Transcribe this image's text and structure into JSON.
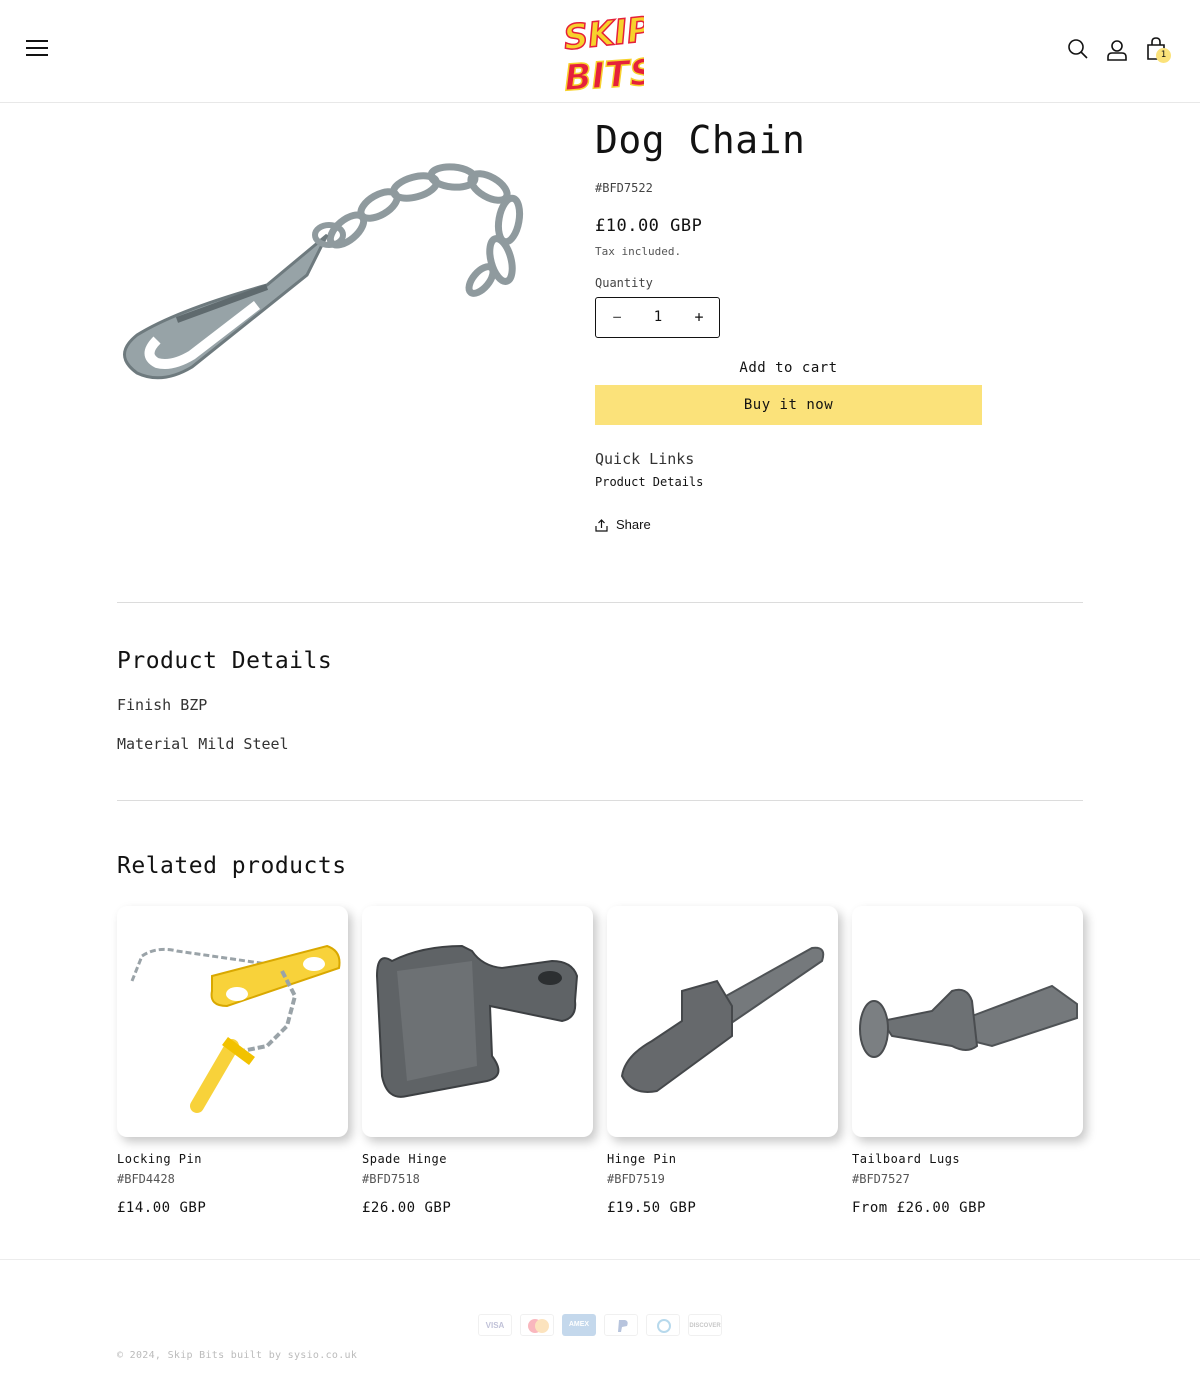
{
  "header": {
    "logo_text_line1": "SKIP",
    "logo_text_line2": "BITS",
    "cart_count": "1",
    "icons": [
      "menu-icon",
      "search-icon",
      "account-icon",
      "cart-icon"
    ]
  },
  "product": {
    "title": "Dog Chain",
    "sku": "#BFD7522",
    "price": "£10.00 GBP",
    "tax_note": "Tax included.",
    "quantity_label": "Quantity",
    "quantity_value": "1",
    "quantity_minus": "−",
    "quantity_plus": "+",
    "add_to_cart": "Add to cart",
    "buy_now": "Buy it now",
    "quick_links_title": "Quick Links",
    "quick_links": [
      "Product Details"
    ],
    "share_label": "Share"
  },
  "details": {
    "heading": "Product Details",
    "lines": [
      "Finish BZP",
      "Material Mild Steel"
    ]
  },
  "related": {
    "heading": "Related products",
    "items": [
      {
        "name": "Locking Pin",
        "sku": "#BFD4428",
        "price": "£14.00 GBP"
      },
      {
        "name": "Spade Hinge",
        "sku": "#BFD7518",
        "price": "£26.00 GBP"
      },
      {
        "name": "Hinge Pin",
        "sku": "#BFD7519",
        "price": "£19.50 GBP"
      },
      {
        "name": "Tailboard Lugs",
        "sku": "#BFD7527",
        "price": "From £26.00 GBP"
      }
    ]
  },
  "footer": {
    "payment_icons": [
      "VISA",
      "",
      "AMEX",
      "",
      "",
      "DISCOVER"
    ],
    "copyright": "© 2024, Skip Bits built by sysio.co.uk"
  },
  "colors": {
    "accent_yellow": "#fbe27a",
    "logo_yellow": "#f7d22c",
    "logo_red": "#e5203a",
    "text": "#121212"
  }
}
